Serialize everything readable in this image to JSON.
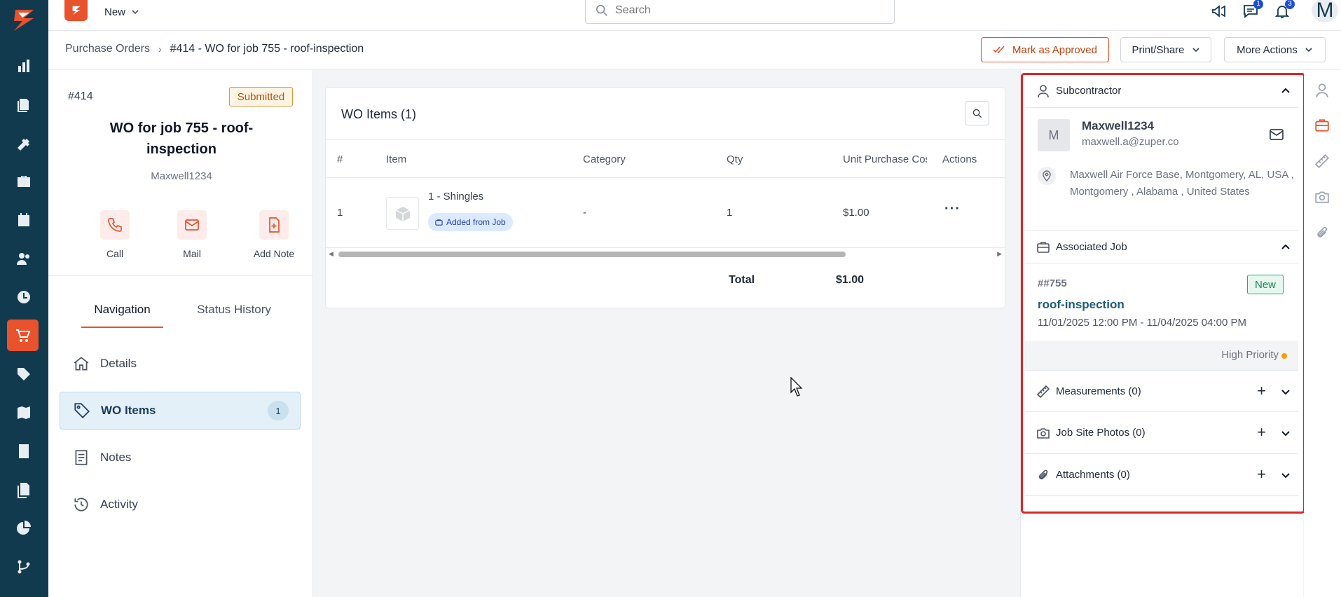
{
  "topbar": {
    "new_label": "New",
    "search_placeholder": "Search",
    "chat_badge": "1",
    "notif_badge": "3",
    "avatar_initial": "M"
  },
  "breadcrumb": {
    "parent": "Purchase Orders",
    "current": "#414 - WO for job 755 - roof-inspection"
  },
  "actions": {
    "approve": "Mark as Approved",
    "print": "Print/Share",
    "more": "More Actions"
  },
  "order": {
    "number": "#414",
    "status": "Submitted",
    "title": "WO for job 755 - roof-inspection",
    "subcontractor": "Maxwell1234"
  },
  "quick_actions": [
    {
      "label": "Call",
      "icon": "phone-icon"
    },
    {
      "label": "Mail",
      "icon": "mail-icon"
    },
    {
      "label": "Add Note",
      "icon": "add-note-icon"
    }
  ],
  "tabs": [
    "Navigation",
    "Status History"
  ],
  "nav": [
    {
      "label": "Details",
      "icon": "home-icon"
    },
    {
      "label": "WO Items",
      "icon": "tag-icon",
      "count": "1"
    },
    {
      "label": "Notes",
      "icon": "notes-icon"
    },
    {
      "label": "Activity",
      "icon": "history-icon"
    }
  ],
  "items_card": {
    "title": "WO Items (1)",
    "columns": [
      "#",
      "Item",
      "Category",
      "Qty",
      "Unit Purchase Cost",
      "Actions"
    ],
    "rows": [
      {
        "num": "1",
        "item": "1 - Shingles",
        "tag": "Added from Job",
        "category": "-",
        "qty": "1",
        "unit_cost": "$1.00"
      }
    ],
    "total_label": "Total",
    "total_value": "$1.00"
  },
  "right_panel": {
    "subcontractor_heading": "Subcontractor",
    "sub_initial": "M",
    "sub_name": "Maxwell1234",
    "sub_email": "maxwell.a@zuper.co",
    "sub_address": "Maxwell Air Force Base, Montgomery, AL, USA , Montgomery , Alabama , United States",
    "job_heading": "Associated Job",
    "job_number": "##755",
    "job_status": "New",
    "job_name": "roof-inspection",
    "job_dates": "11/01/2025 12:00 PM - 11/04/2025 04:00 PM",
    "job_priority": "High Priority",
    "measurements": "Measurements (0)",
    "photos": "Job Site Photos (0)",
    "attachments": "Attachments (0)"
  },
  "colors": {
    "rail": "#123a4f",
    "accent": "#e8522c",
    "highlight": "#dc2626"
  }
}
